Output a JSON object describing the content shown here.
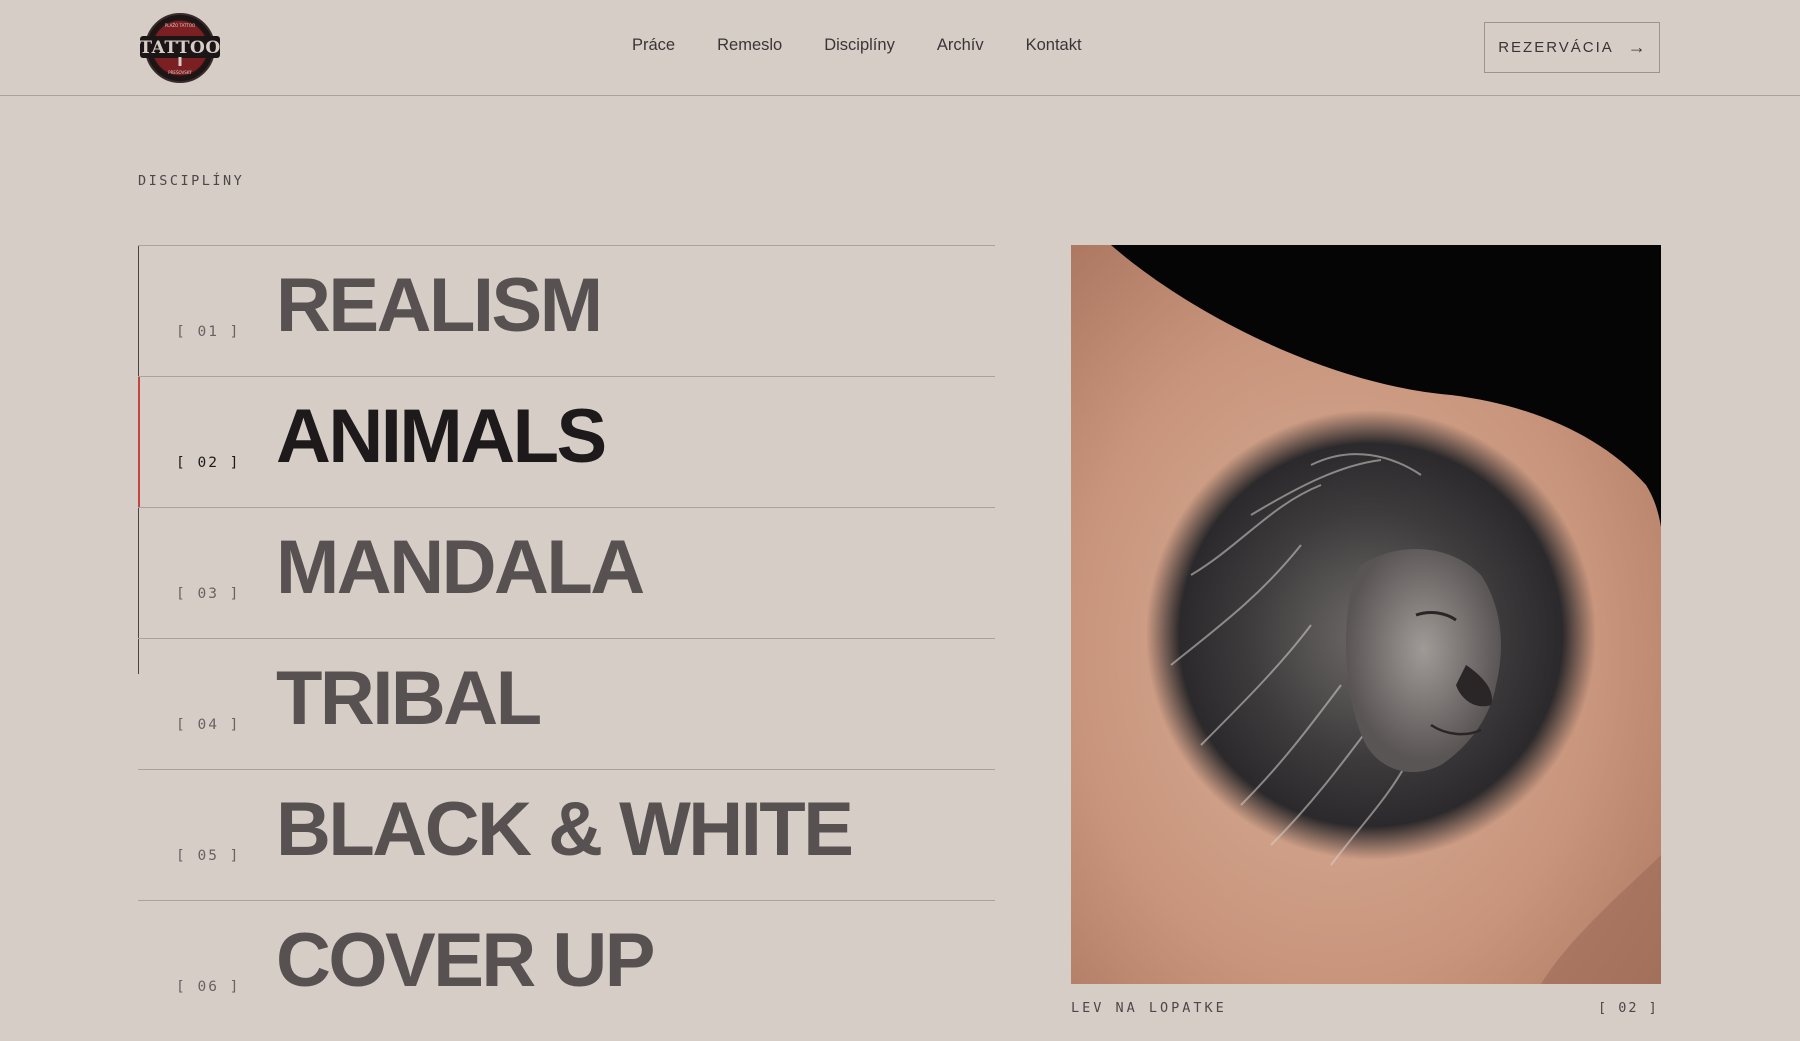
{
  "header": {
    "logo": {
      "wordmark": "TATTOO",
      "top_text": "PLAŽO TATTOO",
      "bottom_text": "PREŠOVSKÝ"
    },
    "nav": [
      "Práce",
      "Remeslo",
      "Disciplíny",
      "Archív",
      "Kontakt"
    ],
    "cta_label": "REZERVÁCIA",
    "cta_icon": "arrow-right-icon"
  },
  "section": {
    "eyebrow": "DISCIPLÍNY",
    "active_index": 1,
    "disciplines": [
      {
        "number": "[ 01 ]",
        "title": "REALISM"
      },
      {
        "number": "[ 02 ]",
        "title": "ANIMALS"
      },
      {
        "number": "[ 03 ]",
        "title": "MANDALA"
      },
      {
        "number": "[ 04 ]",
        "title": "TRIBAL"
      },
      {
        "number": "[ 05 ]",
        "title": "BLACK & WHITE"
      },
      {
        "number": "[ 06 ]",
        "title": "COVER UP"
      }
    ]
  },
  "preview": {
    "caption": "LEV NA LOPATKE",
    "number": "[ 02 ]"
  },
  "colors": {
    "background": "#d6cdc7",
    "text": "#3a3434",
    "active_text": "#1e1a1b",
    "accent": "#c4453f",
    "divider": "#aaa29e"
  }
}
